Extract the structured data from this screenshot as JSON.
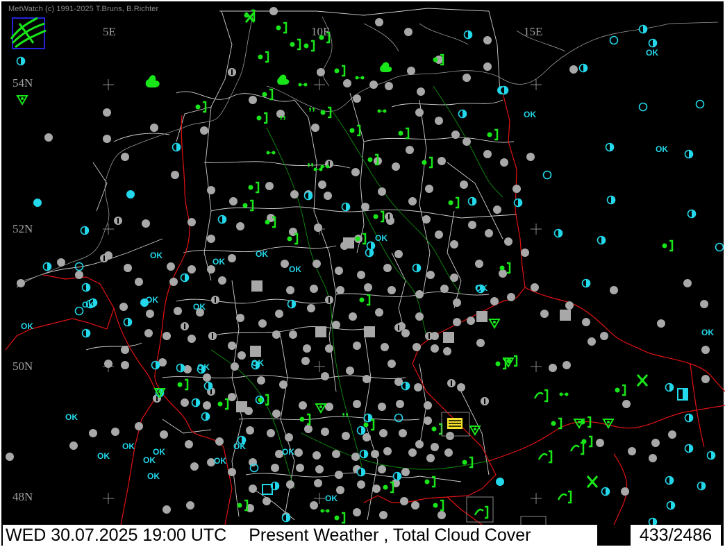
{
  "app": {
    "credit": "MetWatch  (c) 1991-2025 T.Bruns, B.Richter"
  },
  "map": {
    "longitude_labels": [
      "5E",
      "10E",
      "15E"
    ],
    "latitude_labels": [
      "54N",
      "52N",
      "50N",
      "48N"
    ],
    "ok_labels": [
      "OK",
      "OK",
      "OK",
      "OK",
      "OK",
      "OK",
      "OK",
      "OK",
      "OK",
      "OK",
      "OK",
      "OK",
      "OK",
      "OK",
      "OK",
      "OK",
      "OK",
      "OK",
      "OK",
      "OK",
      "OK",
      "OK",
      "OK",
      "OK",
      "OK",
      "OK"
    ],
    "colors": {
      "clouds_full": "#a8a8a8",
      "clouds_partial": "#22d8ea",
      "weather": "#19e619",
      "border": "#e31212",
      "regions": "#d0d0d0",
      "rivers": "#0f8f0f",
      "highlight": "#f2e02a"
    }
  },
  "status_bar": {
    "datetime": "WED 30.07.2025 19:00 UTC",
    "product": "Present Weather    , Total Cloud Cover",
    "count": "433/2486"
  }
}
